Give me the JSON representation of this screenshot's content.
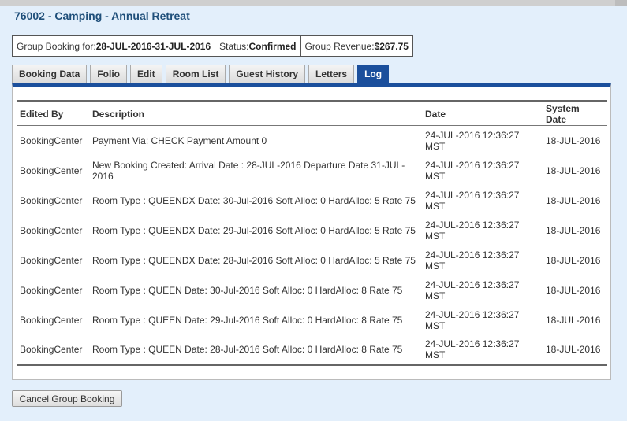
{
  "title": "76002 - Camping - Annual Retreat",
  "summary": {
    "booking_label": "Group Booking for:",
    "booking_value": "28-JUL-2016-31-JUL-2016",
    "status_label": "Status:",
    "status_value": "Confirmed",
    "revenue_label": "Group Revenue:",
    "revenue_value": "$267.75"
  },
  "tabs": [
    "Booking Data",
    "Folio",
    "Edit",
    "Room List",
    "Guest History",
    "Letters",
    "Log"
  ],
  "active_tab": "Log",
  "log": {
    "columns": {
      "edited_by": "Edited By",
      "description": "Description",
      "date": "Date",
      "system_date_line1": "System",
      "system_date_line2": "Date"
    },
    "rows": [
      {
        "edited_by": "BookingCenter",
        "description": "Payment Via: CHECK Payment Amount 0",
        "date": "24-JUL-2016 12:36:27 MST",
        "system_date": "18-JUL-2016"
      },
      {
        "edited_by": "BookingCenter",
        "description": "New Booking Created: Arrival Date : 28-JUL-2016 Departure Date 31-JUL-2016",
        "date": "24-JUL-2016 12:36:27 MST",
        "system_date": "18-JUL-2016"
      },
      {
        "edited_by": "BookingCenter",
        "description": "Room Type : QUEENDX Date: 30-Jul-2016 Soft Alloc: 0 HardAlloc: 5 Rate 75",
        "date": "24-JUL-2016 12:36:27 MST",
        "system_date": "18-JUL-2016"
      },
      {
        "edited_by": "BookingCenter",
        "description": "Room Type : QUEENDX Date: 29-Jul-2016 Soft Alloc: 0 HardAlloc: 5 Rate 75",
        "date": "24-JUL-2016 12:36:27 MST",
        "system_date": "18-JUL-2016"
      },
      {
        "edited_by": "BookingCenter",
        "description": "Room Type : QUEENDX Date: 28-Jul-2016 Soft Alloc: 0 HardAlloc: 5 Rate 75",
        "date": "24-JUL-2016 12:36:27 MST",
        "system_date": "18-JUL-2016"
      },
      {
        "edited_by": "BookingCenter",
        "description": "Room Type : QUEEN Date: 30-Jul-2016 Soft Alloc: 0 HardAlloc: 8 Rate 75",
        "date": "24-JUL-2016 12:36:27 MST",
        "system_date": "18-JUL-2016"
      },
      {
        "edited_by": "BookingCenter",
        "description": "Room Type : QUEEN Date: 29-Jul-2016 Soft Alloc: 0 HardAlloc: 8 Rate 75",
        "date": "24-JUL-2016 12:36:27 MST",
        "system_date": "18-JUL-2016"
      },
      {
        "edited_by": "BookingCenter",
        "description": "Room Type : QUEEN Date: 28-Jul-2016 Soft Alloc: 0 HardAlloc: 8 Rate 75",
        "date": "24-JUL-2016 12:36:27 MST",
        "system_date": "18-JUL-2016"
      }
    ]
  },
  "cancel_button_label": "Cancel Group Booking",
  "colors": {
    "background": "#e3effb",
    "title": "#1f4f7a",
    "active_tab": "#1b4f9c",
    "panel_border_top": "#1b4f9c"
  }
}
